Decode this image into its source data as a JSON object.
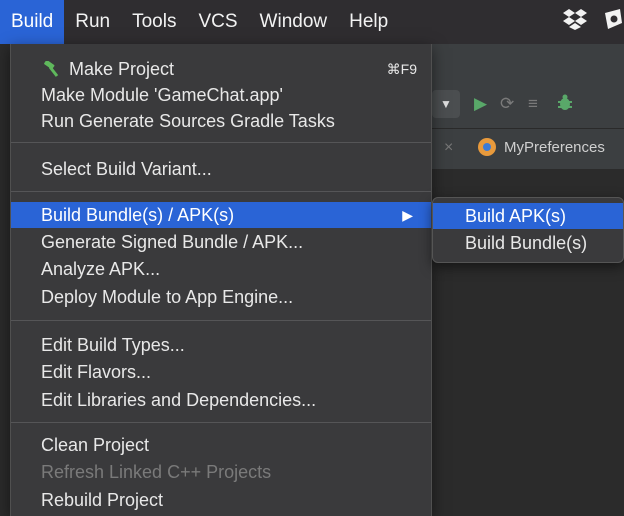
{
  "menubar": {
    "items": [
      "Build",
      "Run",
      "Tools",
      "VCS",
      "Window",
      "Help"
    ],
    "active_index": 0,
    "tray_icons": [
      "dropbox-icon",
      "app-tray-icon"
    ]
  },
  "ide": {
    "tab_file": "MyPreferences",
    "toolbar_icons": [
      "run-icon",
      "apply-changes-icon",
      "debug-list-icon",
      "debug-bug-icon"
    ]
  },
  "menu": {
    "make_project": "Make Project",
    "make_project_shortcut": "⌘F9",
    "make_module": "Make Module 'GameChat.app'",
    "run_generate": "Run Generate Sources Gradle Tasks",
    "select_variant": "Select Build Variant...",
    "build_bundle": "Build Bundle(s) / APK(s)",
    "generate_signed": "Generate Signed Bundle / APK...",
    "analyze_apk": "Analyze APK...",
    "deploy_module": "Deploy Module to App Engine...",
    "edit_build_types": "Edit Build Types...",
    "edit_flavors": "Edit Flavors...",
    "edit_libraries": "Edit Libraries and Dependencies...",
    "clean_project": "Clean Project",
    "refresh_cpp": "Refresh Linked C++ Projects",
    "rebuild_project": "Rebuild Project"
  },
  "submenu": {
    "build_apk": "Build APK(s)",
    "build_bundle": "Build Bundle(s)"
  },
  "colors": {
    "highlight": "#2a64d6",
    "menu_bg": "#3a3a3c",
    "disabled_text": "#7a7a7a",
    "hammer_green": "#5fb85c"
  }
}
